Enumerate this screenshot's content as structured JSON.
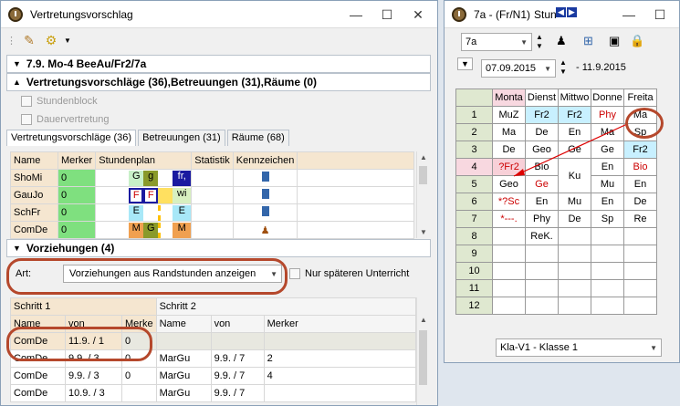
{
  "w1": {
    "title": "Vertretungsvorschlag",
    "header": "7.9. Mo-4 BeeAu/Fr2/7a",
    "vorschlaege": "Vertretungsvorschläge (36),Betreuungen (31),Räume (0)",
    "chk1": "Stundenblock",
    "chk2": "Dauervertretung",
    "tabs": [
      "Vertretungsvorschläge (36)",
      "Betreuungen (31)",
      "Räume (68)"
    ],
    "cols": [
      "Name",
      "Merker",
      "Stundenplan",
      "Statistik",
      "Kennzeichen"
    ],
    "rows": [
      {
        "name": "ShoMi",
        "merker": "0",
        "p1": "G",
        "p2": "g",
        "p3": "fr,"
      },
      {
        "name": "GauJo",
        "merker": "0",
        "p1": "F",
        "p2": "F",
        "p3": "wi"
      },
      {
        "name": "SchFr",
        "merker": "0",
        "p1": "E",
        "p2": "E",
        "p3": "E"
      },
      {
        "name": "ComDe",
        "merker": "0",
        "p1": "M",
        "p2": "G",
        "p3": "M"
      }
    ],
    "vorziehungen": "Vorziehungen (4)",
    "art_label": "Art:",
    "art_value": "Vorziehungen aus Randstunden anzeigen",
    "nur": "Nur späteren Unterricht",
    "schritt1": "Schritt 1",
    "schritt2": "Schritt 2",
    "vcols": [
      "Name",
      "von",
      "Merke",
      "Name",
      "von",
      "Merker"
    ],
    "vrows": [
      [
        "ComDe",
        "11.9. / 1",
        "0",
        "",
        "",
        ""
      ],
      [
        "ComDe",
        "9.9. / 3",
        "0",
        "MarGu",
        "9.9. / 7",
        "2"
      ],
      [
        "ComDe",
        "9.9. / 3",
        "0",
        "MarGu",
        "9.9. / 7",
        "4"
      ],
      [
        "ComDe",
        "10.9. / 3",
        "",
        "MarGu",
        "9.9. / 7",
        ""
      ]
    ]
  },
  "w2": {
    "title": "7a - (Fr/N1)",
    "title_suffix": "Stun",
    "class_value": "7a",
    "date_from": "07.09.2015",
    "date_to": "- 11.9.2015",
    "days": [
      "Monta",
      "Dienst",
      "Mittwo",
      "Donne",
      "Freita"
    ],
    "periods": [
      "1",
      "2",
      "3",
      "4",
      "5",
      "6",
      "7",
      "8",
      "9",
      "10",
      "11",
      "12"
    ],
    "cells": [
      [
        "MuZ",
        "Fr2",
        "Fr2",
        "Phy",
        "Ma"
      ],
      [
        "Ma",
        "De",
        "En",
        "Ma",
        "Sp"
      ],
      [
        "De",
        "Geo",
        "Ge",
        "Ge",
        "Fr2"
      ],
      [
        "?Fr2",
        "Bio",
        "",
        "En",
        "Bio"
      ],
      [
        "Geo",
        "Ge",
        "Ku",
        "Mu",
        "En"
      ],
      [
        "*?Sc",
        "En",
        "Mu",
        "En",
        "De"
      ],
      [
        "*---.",
        "Phy",
        "De",
        "Sp",
        "Re"
      ],
      [
        "",
        "ReK.",
        "",
        "",
        ""
      ],
      [
        "",
        "",
        "",
        "",
        ""
      ],
      [
        "",
        "",
        "",
        "",
        ""
      ],
      [
        "",
        "",
        "",
        "",
        ""
      ],
      [
        "",
        "",
        "",
        "",
        ""
      ]
    ],
    "bottom_select": "Kla-V1 - Klasse 1"
  }
}
